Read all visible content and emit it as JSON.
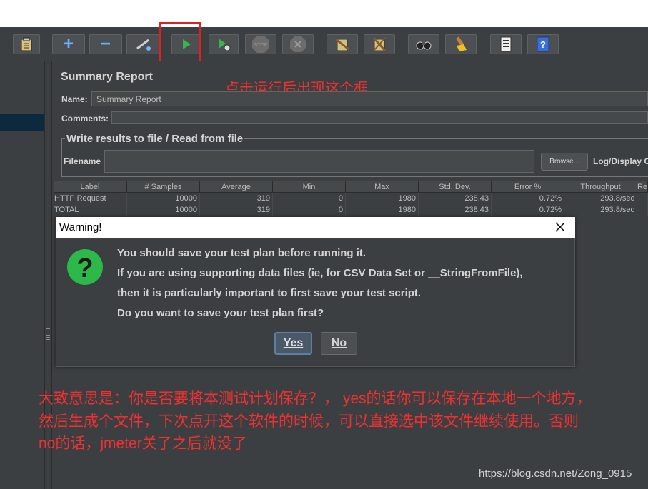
{
  "toolbar": {
    "buttons": [
      {
        "name": "templates-icon"
      },
      {
        "name": "expand-all-icon",
        "glyph": "+"
      },
      {
        "name": "collapse-all-icon",
        "glyph": "−"
      },
      {
        "name": "toggle-icon"
      },
      {
        "name": "start-icon"
      },
      {
        "name": "start-no-pauses-icon"
      },
      {
        "name": "stop-icon",
        "glyph": "STOP"
      },
      {
        "name": "shutdown-icon"
      },
      {
        "name": "clear-icon"
      },
      {
        "name": "clear-all-icon"
      },
      {
        "name": "search-icon"
      },
      {
        "name": "reset-search-icon"
      },
      {
        "name": "function-helper-icon"
      },
      {
        "name": "help-icon",
        "glyph": "?"
      }
    ]
  },
  "panel": {
    "title": "Summary Report",
    "name_label": "Name:",
    "name_value": "Summary Report",
    "comments_label": "Comments:",
    "file_section_title": "Write results to file / Read from file",
    "filename_label": "Filename",
    "browse_label": "Browse...",
    "log_display_label": "Log/Display O"
  },
  "table": {
    "headers": [
      "Label",
      "# Samples",
      "Average",
      "Min",
      "Max",
      "Std. Dev.",
      "Error %",
      "Throughput",
      "Re"
    ],
    "rows": [
      [
        "HTTP Request",
        "10000",
        "319",
        "0",
        "1980",
        "238.43",
        "0.72%",
        "293.8/sec",
        ""
      ],
      [
        "TOTAL",
        "10000",
        "319",
        "0",
        "1980",
        "238.43",
        "0.72%",
        "293.8/sec",
        ""
      ]
    ]
  },
  "dialog": {
    "title": "Warning!",
    "messages": [
      "You should save your test plan before running it.",
      "If you are using supporting data files (ie, for CSV Data Set or __StringFromFile),",
      "then it is particularly important to first save your test script.",
      "Do you want to save your test plan first?"
    ],
    "yes_label": "Yes",
    "no_label": "No"
  },
  "annotations": {
    "top": "点击运行后出现这个框",
    "bottom": [
      "大致意思是：你是否要将本测试计划保存？， yes的话你可以保存在本地一个地方，",
      "然后生成个文件，下次点开这个软件的时候，可以直接选中该文件继续使用。否则",
      "no的话，jmeter关了之后就没了"
    ]
  },
  "watermark": "https://blog.csdn.net/Zong_0915",
  "colors": {
    "annotation": "#f03030",
    "background": "#3c3f41"
  }
}
